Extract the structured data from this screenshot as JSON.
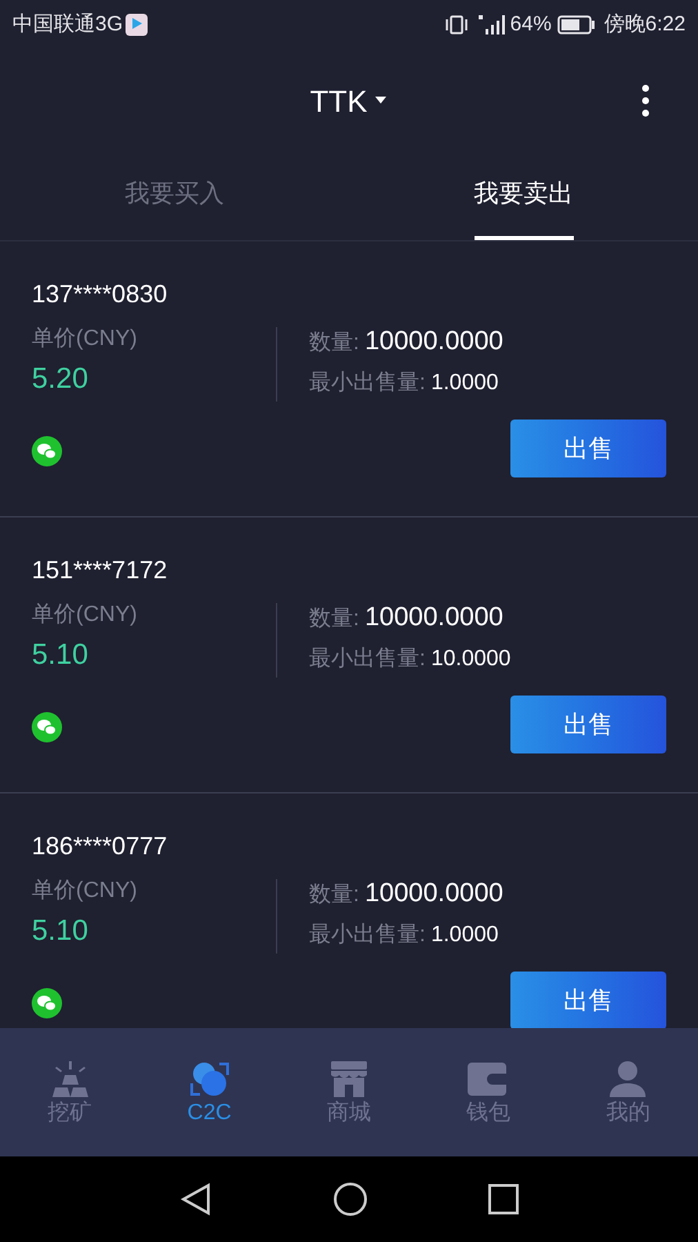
{
  "status_bar": {
    "carrier": "中国联通3G",
    "battery": "64%",
    "time": "傍晚6:22"
  },
  "header": {
    "title": "TTK"
  },
  "tabs": [
    {
      "label": "我要买入",
      "selected": false
    },
    {
      "label": "我要卖出",
      "selected": true
    }
  ],
  "orders": [
    {
      "user": "137****0830",
      "price_label": "单价(CNY)",
      "price": "5.20",
      "quantity_label": "数量:",
      "quantity": "10000.0000",
      "min_label": "最小出售量:",
      "min": "1.0000",
      "action": "出售"
    },
    {
      "user": "151****7172",
      "price_label": "单价(CNY)",
      "price": "5.10",
      "quantity_label": "数量:",
      "quantity": "10000.0000",
      "min_label": "最小出售量:",
      "min": "10.0000",
      "action": "出售"
    },
    {
      "user": "186****0777",
      "price_label": "单价(CNY)",
      "price": "5.10",
      "quantity_label": "数量:",
      "quantity": "10000.0000",
      "min_label": "最小出售量:",
      "min": "1.0000",
      "action": "出售"
    }
  ],
  "bottom_nav": [
    {
      "kind": "mining",
      "label": "挖矿",
      "selected": false
    },
    {
      "kind": "c2c",
      "label": "C2C",
      "selected": true
    },
    {
      "kind": "store",
      "label": "商城",
      "selected": false
    },
    {
      "kind": "wallet",
      "label": "钱包",
      "selected": false
    },
    {
      "kind": "profile",
      "label": "我的",
      "selected": false
    }
  ]
}
